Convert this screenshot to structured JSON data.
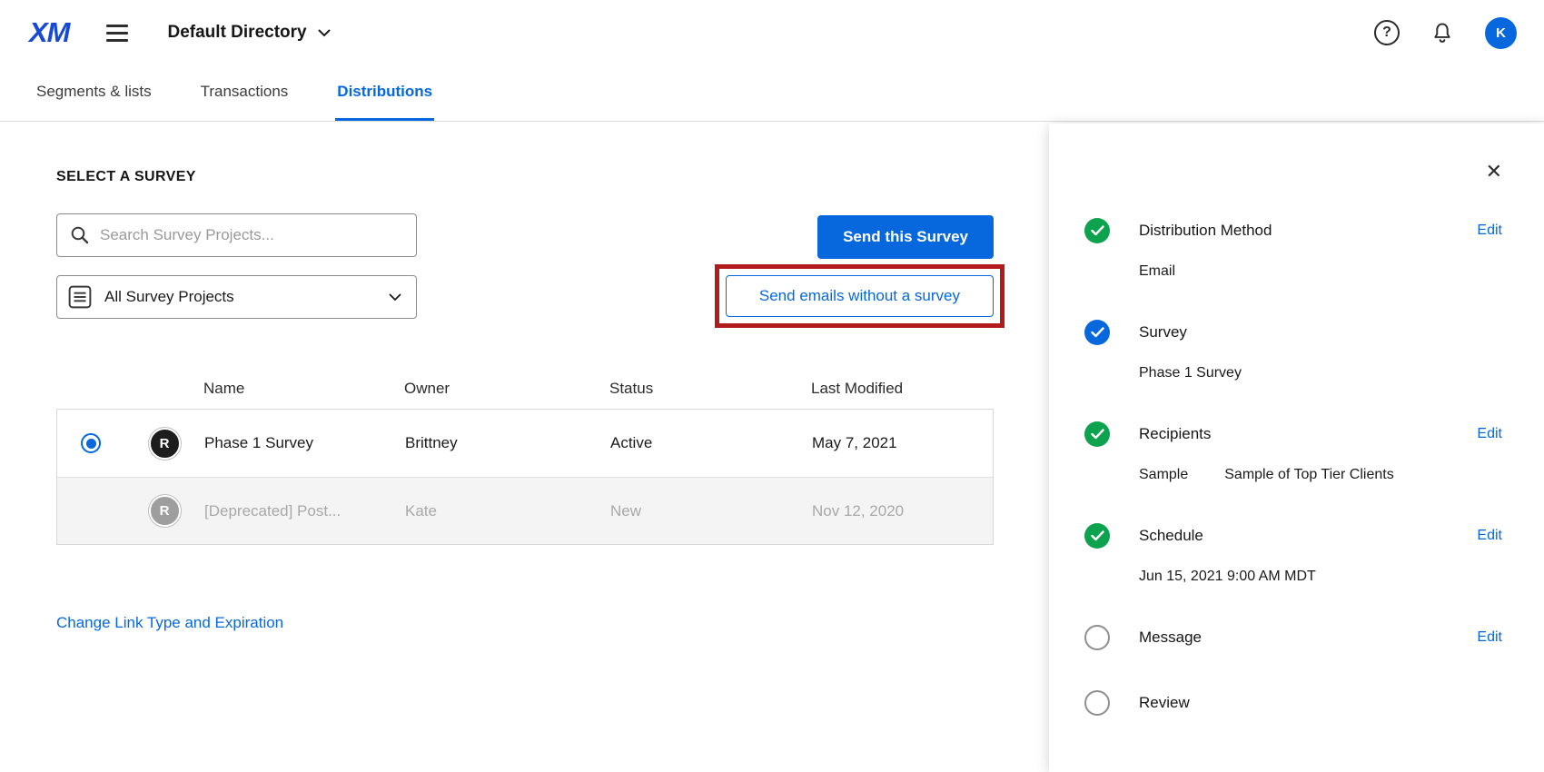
{
  "header": {
    "logo": "XM",
    "directory": {
      "label": "Default Directory"
    },
    "avatar_initial": "K",
    "help_icon": "?"
  },
  "tabs": {
    "items": [
      {
        "label": "Segments & lists"
      },
      {
        "label": "Transactions"
      },
      {
        "label": "Distributions"
      }
    ],
    "active": "Distributions"
  },
  "survey_picker": {
    "title": "SELECT A SURVEY",
    "search_placeholder": "Search Survey Projects...",
    "project_filter_value": "All Survey Projects",
    "send_this_survey_label": "Send this Survey",
    "send_without_survey_label": "Send emails without a survey",
    "change_link_label": "Change Link Type and Expiration",
    "table": {
      "columns": {
        "name": "Name",
        "owner": "Owner",
        "status": "Status",
        "last_modified": "Last Modified"
      },
      "rows": [
        {
          "avatar": "R",
          "name": "Phase 1 Survey",
          "owner": "Brittney",
          "status": "Active",
          "last_modified": "May 7, 2021",
          "selected": true
        },
        {
          "avatar": "R",
          "name": "[Deprecated] Post...",
          "owner": "Kate",
          "status": "New",
          "last_modified": "Nov 12, 2020",
          "selected": false
        }
      ]
    }
  },
  "panel": {
    "close_icon": "✕",
    "steps": [
      {
        "label": "Distribution Method",
        "state": "complete-green",
        "edit": "Edit",
        "detail": "Email"
      },
      {
        "label": "Survey",
        "state": "complete-blue",
        "detail": "Phase 1 Survey"
      },
      {
        "label": "Recipients",
        "state": "complete-green",
        "edit": "Edit",
        "detail_type": "Sample",
        "detail": "Sample of Top Tier Clients"
      },
      {
        "label": "Schedule",
        "state": "complete-green",
        "edit": "Edit",
        "detail": "Jun 15, 2021 9:00 AM MDT"
      },
      {
        "label": "Message",
        "state": "incomplete",
        "edit": "Edit"
      },
      {
        "label": "Review",
        "state": "incomplete"
      }
    ]
  },
  "colors": {
    "accent_blue": "#0768dd",
    "success_green": "#0ca24e",
    "annotation_red": "#b11b1b"
  }
}
